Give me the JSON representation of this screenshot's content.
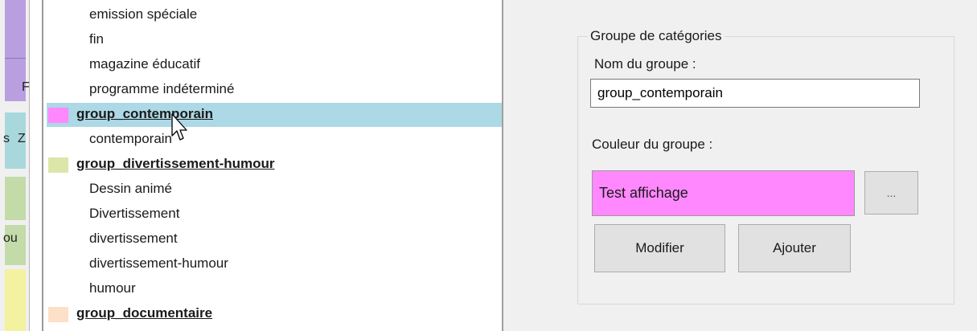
{
  "left_strip": {
    "texts": [
      "F",
      "s",
      "Z",
      "ou"
    ]
  },
  "tree": {
    "rows": [
      {
        "kind": "item",
        "label": "emission spéciale"
      },
      {
        "kind": "item",
        "label": "fin"
      },
      {
        "kind": "item",
        "label": "magazine éducatif"
      },
      {
        "kind": "item",
        "label": "programme indéterminé"
      },
      {
        "kind": "group",
        "label": "group_contemporain",
        "color": "#ff88ff",
        "selected": true
      },
      {
        "kind": "item",
        "label": "contemporain"
      },
      {
        "kind": "group",
        "label": "group_divertissement-humour",
        "color": "#dce6a8"
      },
      {
        "kind": "item",
        "label": "Dessin animé"
      },
      {
        "kind": "item",
        "label": "Divertissement"
      },
      {
        "kind": "item",
        "label": "divertissement"
      },
      {
        "kind": "item",
        "label": "divertissement-humour"
      },
      {
        "kind": "item",
        "label": "humour"
      },
      {
        "kind": "group",
        "label": "group_documentaire",
        "color": "#fde0c8"
      }
    ]
  },
  "editor": {
    "groupbox_title": "Groupe de catégories",
    "name_label": "Nom du groupe :",
    "name_value": "group_contemporain",
    "color_label": "Couleur du groupe :",
    "preview_text": "Test affichage",
    "preview_color": "#ff88ff",
    "picker_label": "...",
    "modify_label": "Modifier",
    "add_label": "Ajouter"
  },
  "colors": {
    "selection": "#add8e6",
    "panel_bg": "#f0f0f0"
  }
}
